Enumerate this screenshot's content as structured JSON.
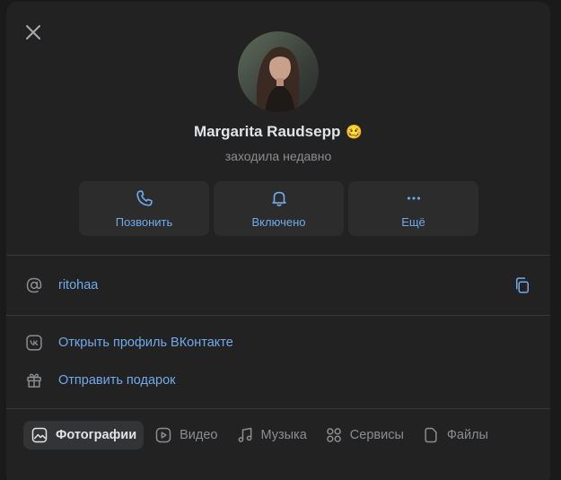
{
  "profile": {
    "name": "Margarita Raudsepp",
    "name_emoji": "🥴",
    "status": "заходила недавно"
  },
  "actions": [
    {
      "label": "Позвонить",
      "icon": "phone-icon"
    },
    {
      "label": "Включено",
      "icon": "bell-icon"
    },
    {
      "label": "Ещё",
      "icon": "more-icon"
    }
  ],
  "info": {
    "username": "ritohaa",
    "vk_profile_link": "Открыть профиль ВКонтакте",
    "gift_link": "Отправить подарок"
  },
  "tabs": [
    {
      "label": "Фотографии",
      "icon": "photo-icon",
      "active": true
    },
    {
      "label": "Видео",
      "icon": "video-icon",
      "active": false
    },
    {
      "label": "Музыка",
      "icon": "music-icon",
      "active": false
    },
    {
      "label": "Сервисы",
      "icon": "services-icon",
      "active": false
    },
    {
      "label": "Файлы",
      "icon": "file-icon",
      "active": false
    }
  ],
  "colors": {
    "accent": "#71aaeb",
    "panel": "#222222",
    "muted": "#8b8d91"
  }
}
